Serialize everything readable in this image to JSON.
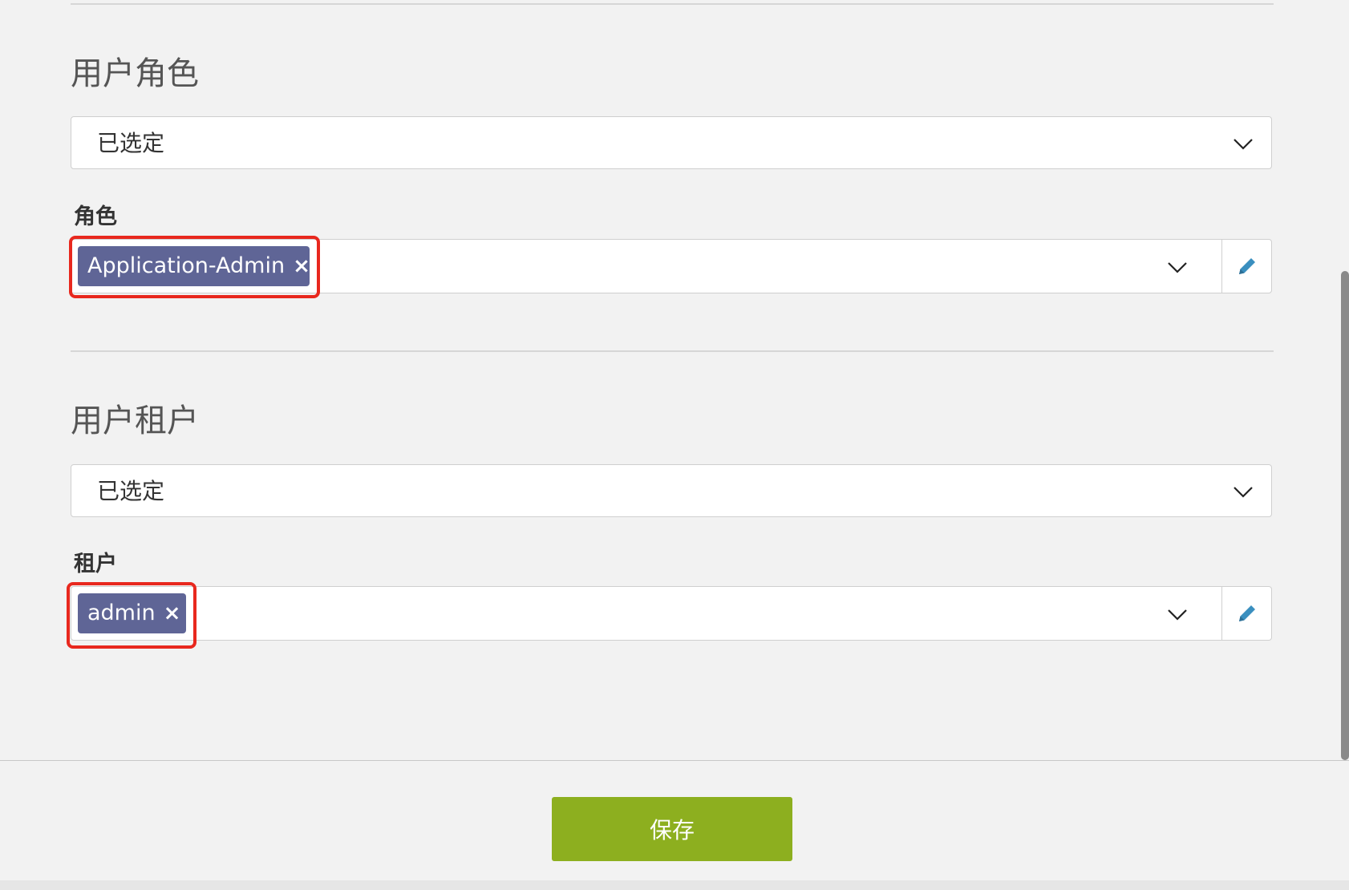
{
  "roles_section": {
    "title": "用户角色",
    "filter_select": {
      "value": "已选定"
    },
    "field_label": "角色",
    "tags": [
      {
        "label": "Application-Admin",
        "remove_icon": "×"
      }
    ]
  },
  "tenants_section": {
    "title": "用户租户",
    "filter_select": {
      "value": "已选定"
    },
    "field_label": "租户",
    "tags": [
      {
        "label": "admin",
        "remove_icon": "×"
      }
    ]
  },
  "footer": {
    "save_label": "保存"
  },
  "colors": {
    "tag_bg": "#5f6596",
    "save_bg": "#8daf1f",
    "highlight": "#e8281e",
    "edit_icon": "#3a8fbf"
  },
  "icons": {
    "dropdown": "chevron-down-icon",
    "edit": "pencil-icon",
    "tag_remove": "close-icon"
  }
}
